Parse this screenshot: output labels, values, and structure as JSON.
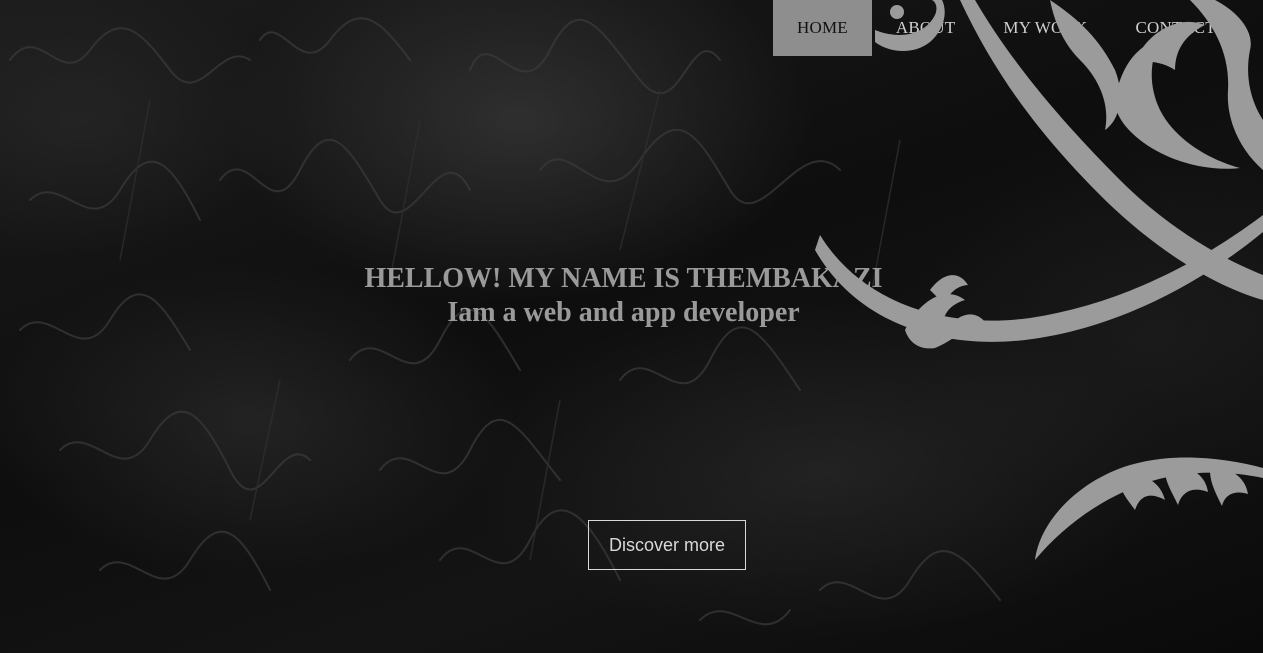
{
  "nav": {
    "items": [
      {
        "label": "HOME",
        "active": true
      },
      {
        "label": "ABOUT",
        "active": false
      },
      {
        "label": "MY WORK",
        "active": false
      },
      {
        "label": "CONTACT",
        "active": false
      }
    ]
  },
  "hero": {
    "title": "HELLOW! MY NAME IS THEMBAKAZI",
    "subtitle": "Iam a web and app developer",
    "cta_label": "Discover more"
  },
  "colors": {
    "background": "#0c0c0c",
    "nav_active_bg": "#8e8e8e",
    "nav_text": "#cfcfcf",
    "headline": "#9a9a9a",
    "flourish": "#9b9b9b"
  },
  "decor": {
    "background_image": "handwriting-texture",
    "ornament": "swirl-flourish-ornament"
  }
}
